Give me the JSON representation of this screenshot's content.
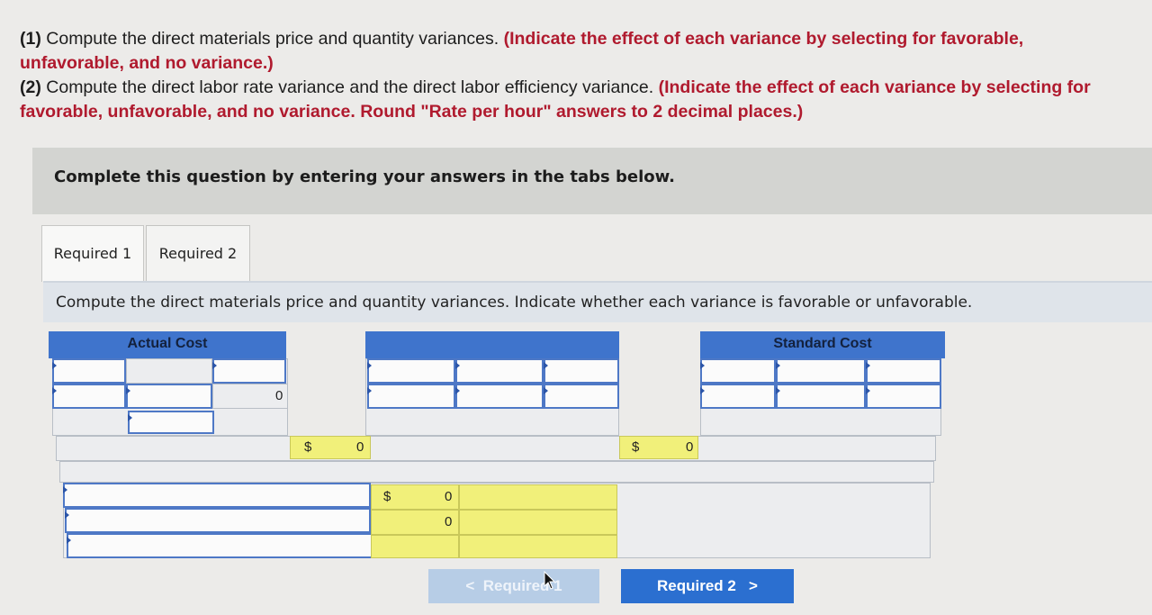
{
  "question": {
    "part1_num": "(1)",
    "part1_text": " Compute the direct materials price and quantity variances. ",
    "part1_red": "(Indicate the effect of each variance by selecting for favorable, unfavorable, and no variance.)",
    "part2_num": "(2)",
    "part2_text": " Compute the direct labor rate variance and the direct labor efficiency variance. ",
    "part2_red": "(Indicate the effect of each variance by selecting for favorable, unfavorable, and no variance. Round \"Rate per hour\" answers to 2 decimal places.)"
  },
  "banner": "Complete this question by entering your answers in the tabs below.",
  "tabs": [
    "Required 1",
    "Required 2"
  ],
  "instruction": "Compute the direct materials price and quantity variances. Indicate whether each variance is favorable or unfavorable.",
  "table": {
    "actual_cost_header": "Actual Cost",
    "standard_cost_header": "Standard Cost",
    "actual_total": "0",
    "actual_dollar": "$",
    "actual_amount": "0",
    "standard_dollar": "$",
    "standard_amount": "0",
    "variance_dollar": "$",
    "variance_1": "0",
    "variance_2": "0"
  },
  "nav": {
    "prev_label": "Required 1",
    "next_label": "Required 2",
    "prev_chevron": "<",
    "next_chevron": ">"
  }
}
